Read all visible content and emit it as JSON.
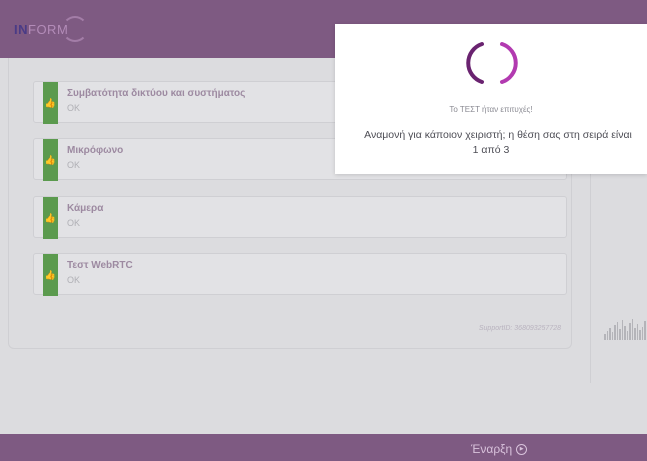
{
  "header": {
    "logo_prefix": "IN",
    "logo_suffix": "FORM",
    "background": "#7e5a82"
  },
  "checks": [
    {
      "title": "Συμβατότητα δικτύου και συστήματος",
      "status": "OK",
      "icon": "thumbs-up-icon"
    },
    {
      "title": "Μικρόφωνο",
      "status": "OK",
      "icon": "thumbs-up-icon"
    },
    {
      "title": "Κάμερα",
      "status": "OK",
      "icon": "thumbs-up-icon"
    },
    {
      "title": "Τεστ WebRTC",
      "status": "OK",
      "icon": "thumbs-up-icon"
    }
  ],
  "support_id": "SupportID: 368093257728",
  "footer": {
    "start_label": "Έναρξη",
    "start_icon": "play-circle-icon"
  },
  "modal": {
    "spinner_icon": "loading-spinner-icon",
    "status_text": "Το ΤΕΣΤ ήταν επιτυχές!",
    "queue_text": "Αναμονή για κάποιον χειριστή; η θέση σας στη σειρά είναι",
    "queue_position": "1 από 3"
  },
  "colors": {
    "accent": "#7e5a82",
    "success": "#5b9a4e",
    "spinner_dark": "#6a2370",
    "spinner_light": "#b23ab0"
  }
}
